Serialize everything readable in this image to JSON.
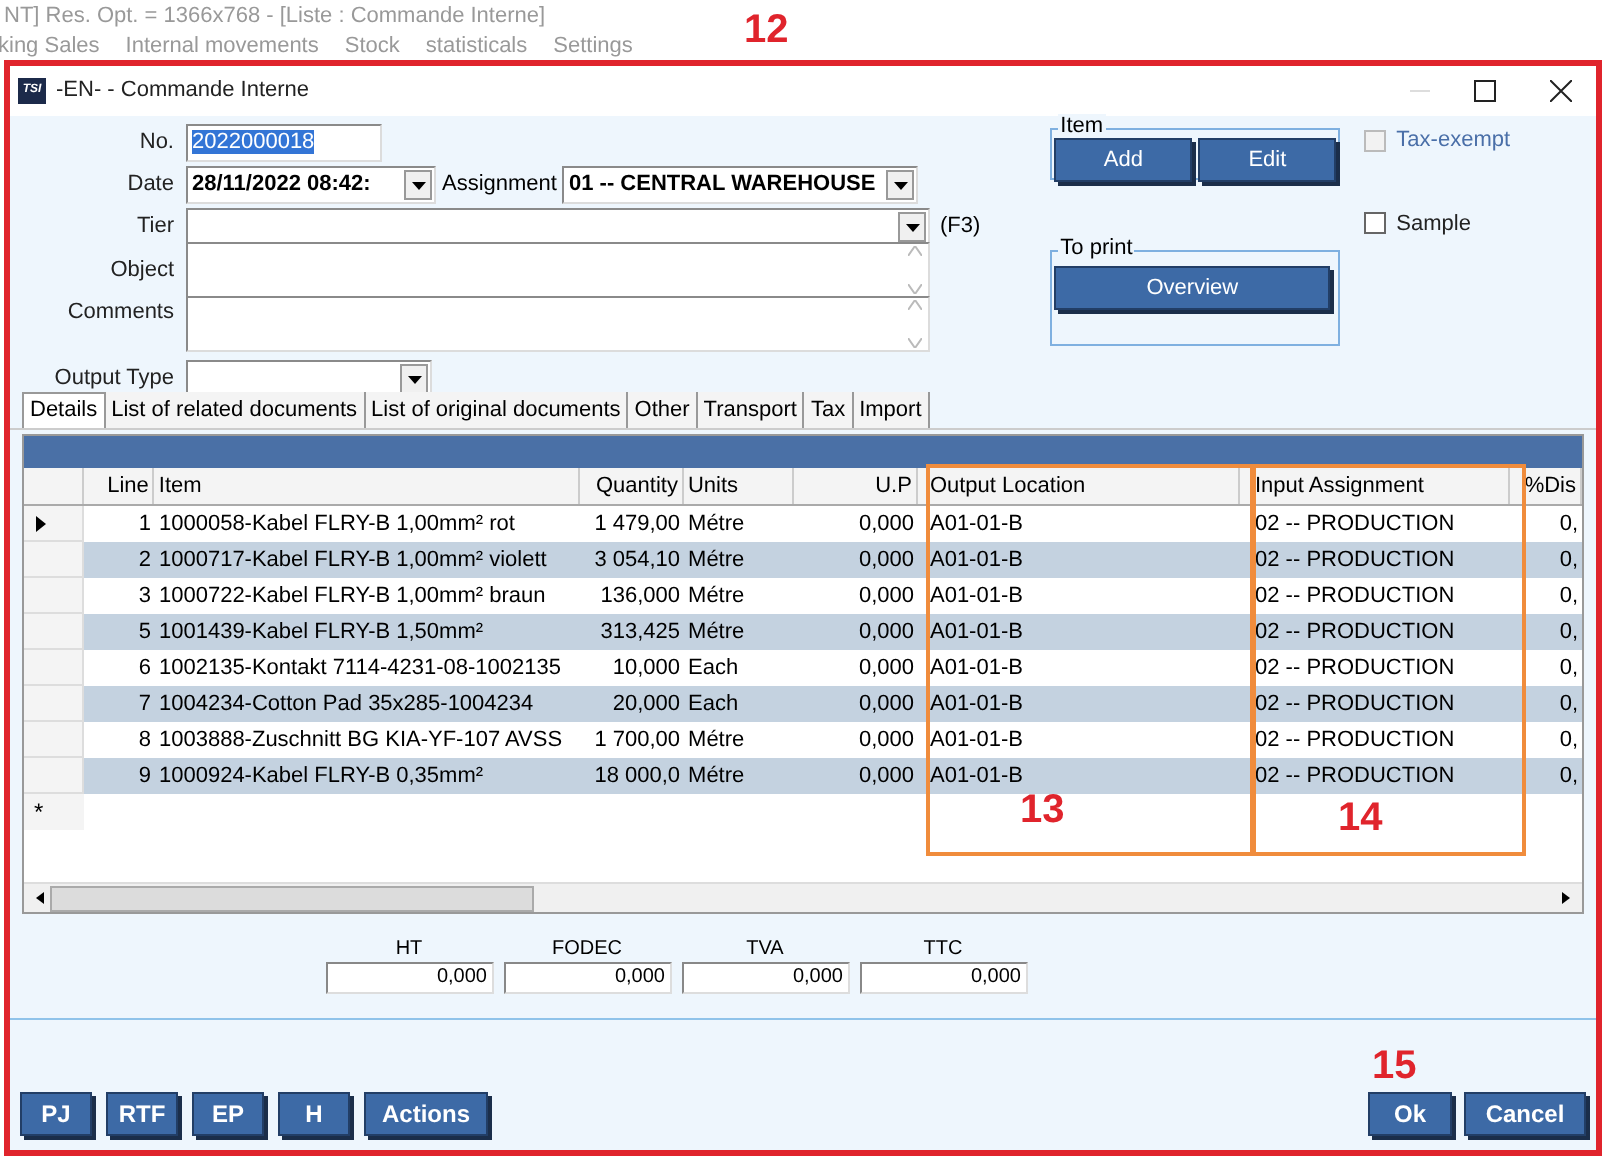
{
  "app_title": "NT] Res. Opt. = 1366x768 - [Liste : Commande Interne]",
  "menu": [
    "king Sales",
    "Internal movements",
    "Stock",
    "statisticals",
    "Settings"
  ],
  "callouts": [
    "12",
    "13",
    "14",
    "15"
  ],
  "window": {
    "title": "-EN- - Commande Interne",
    "app_icon": "TSI"
  },
  "form": {
    "no": {
      "label": "No.",
      "value": "2022000018"
    },
    "date": {
      "label": "Date",
      "value": "28/11/2022 08:42:"
    },
    "assignment": {
      "label": "Assignment",
      "value": "01 -- CENTRAL WAREHOUSE"
    },
    "tier": {
      "label": "Tier",
      "hint": "(F3)"
    },
    "object": {
      "label": "Object"
    },
    "comments": {
      "label": "Comments"
    },
    "output_type": {
      "label": "Output Type"
    }
  },
  "item_group": {
    "title": "Item",
    "buttons": [
      "Add",
      "Edit"
    ]
  },
  "print_group": {
    "title": "To print",
    "buttons": [
      "Overview"
    ]
  },
  "checkboxes": [
    {
      "label": "Tax-exempt",
      "checked": false,
      "disabled": true
    },
    {
      "label": "Sample",
      "checked": false,
      "disabled": false
    }
  ],
  "tabs": [
    {
      "label": "Details",
      "selected": true
    },
    {
      "label": "List of related documents",
      "selected": false
    },
    {
      "label": "List of original documents",
      "selected": false
    },
    {
      "label": "Other",
      "selected": false
    },
    {
      "label": "Transport",
      "selected": false
    },
    {
      "label": "Tax",
      "selected": false
    },
    {
      "label": "Import",
      "selected": false
    }
  ],
  "table": {
    "columns": [
      "Line",
      "Item",
      "Quantity",
      "Units",
      "U.P",
      "Output Location",
      "Input Assignment",
      "%Dis"
    ],
    "rows": [
      {
        "current": true,
        "cells": [
          "1",
          "1000058-Kabel FLRY-B 1,00mm² rot",
          "1 479,00",
          "Métre",
          "0,000",
          "A01-01-B",
          "02 -- PRODUCTION",
          "0,"
        ]
      },
      {
        "current": false,
        "cells": [
          "2",
          "1000717-Kabel FLRY-B 1,00mm² violett",
          "3 054,10",
          "Métre",
          "0,000",
          "A01-01-B",
          "02 -- PRODUCTION",
          "0,"
        ]
      },
      {
        "current": false,
        "cells": [
          "3",
          "1000722-Kabel FLRY-B 1,00mm² braun",
          "136,000",
          "Métre",
          "0,000",
          "A01-01-B",
          "02 -- PRODUCTION",
          "0,"
        ]
      },
      {
        "current": false,
        "cells": [
          "5",
          "1001439-Kabel FLRY-B 1,50mm²",
          "313,425",
          "Métre",
          "0,000",
          "A01-01-B",
          "02 -- PRODUCTION",
          "0,"
        ]
      },
      {
        "current": false,
        "cells": [
          "6",
          "1002135-Kontakt 7114-4231-08-1002135",
          "10,000",
          "Each",
          "0,000",
          "A01-01-B",
          "02 -- PRODUCTION",
          "0,"
        ]
      },
      {
        "current": false,
        "cells": [
          "7",
          "1004234-Cotton Pad 35x285-1004234",
          "20,000",
          "Each",
          "0,000",
          "A01-01-B",
          "02 -- PRODUCTION",
          "0,"
        ]
      },
      {
        "current": false,
        "cells": [
          "8",
          "1003888-Zuschnitt BG KIA-YF-107 AVSS",
          "1 700,00",
          "Métre",
          "0,000",
          "A01-01-B",
          "02 -- PRODUCTION",
          "0,"
        ]
      },
      {
        "current": false,
        "cells": [
          "9",
          "1000924-Kabel FLRY-B 0,35mm²",
          "18 000,0",
          "Métre",
          "0,000",
          "A01-01-B",
          "02 -- PRODUCTION",
          "0,"
        ]
      }
    ],
    "new_row_marker": "*"
  },
  "totals": [
    {
      "label": "HT",
      "value": "0,000"
    },
    {
      "label": "FODEC",
      "value": "0,000"
    },
    {
      "label": "TVA",
      "value": "0,000"
    },
    {
      "label": "TTC",
      "value": "0,000"
    }
  ],
  "left_buttons": [
    "PJ",
    "RTF",
    "EP",
    "H",
    "Actions"
  ],
  "right_buttons": [
    "Ok",
    "Cancel"
  ]
}
